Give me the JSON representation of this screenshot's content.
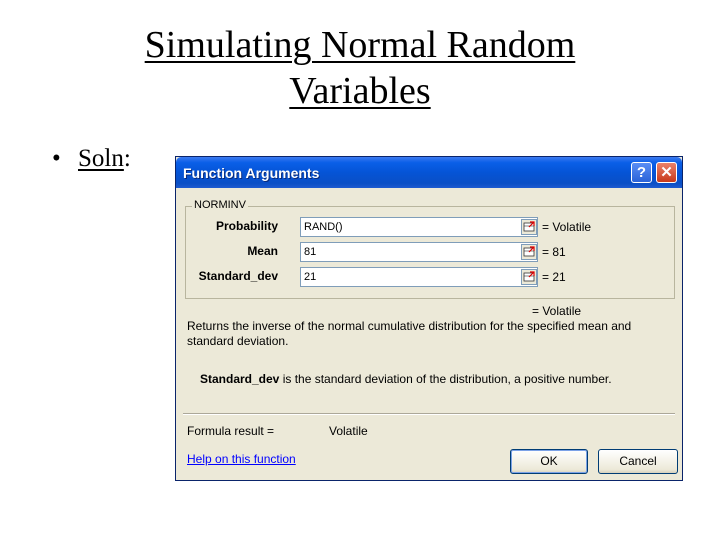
{
  "slide": {
    "title_line1": "Simulating Normal Random",
    "title_line2": "Variables",
    "bullet_char": "•",
    "bullet_label": "Soln",
    "bullet_colon": ":"
  },
  "dialog": {
    "title": "Function Arguments",
    "help_glyph": "?",
    "close_glyph": "✕",
    "function_name": "NORMINV",
    "args": [
      {
        "label": "Probability",
        "value": "RAND()",
        "result": "= Volatile"
      },
      {
        "label": "Mean",
        "value": "81",
        "result": "= 81"
      },
      {
        "label": "Standard_dev",
        "value": "21",
        "result": "= 21"
      }
    ],
    "overall_result": "= Volatile",
    "description": "Returns the inverse of the normal cumulative distribution for the specified mean and standard deviation.",
    "param_name": "Standard_dev",
    "param_description": " is the standard deviation of the distribution, a positive number.",
    "formula_result_label": "Formula result =",
    "formula_result_value": "Volatile",
    "help_link": "Help on this function",
    "ok_label": "OK",
    "cancel_label": "Cancel"
  },
  "icons": {
    "ref_button": "collapse-dialog-icon"
  },
  "colors": {
    "titlebar": "#0554d6",
    "dialog_bg": "#ece9d8",
    "link": "#0000ff"
  }
}
